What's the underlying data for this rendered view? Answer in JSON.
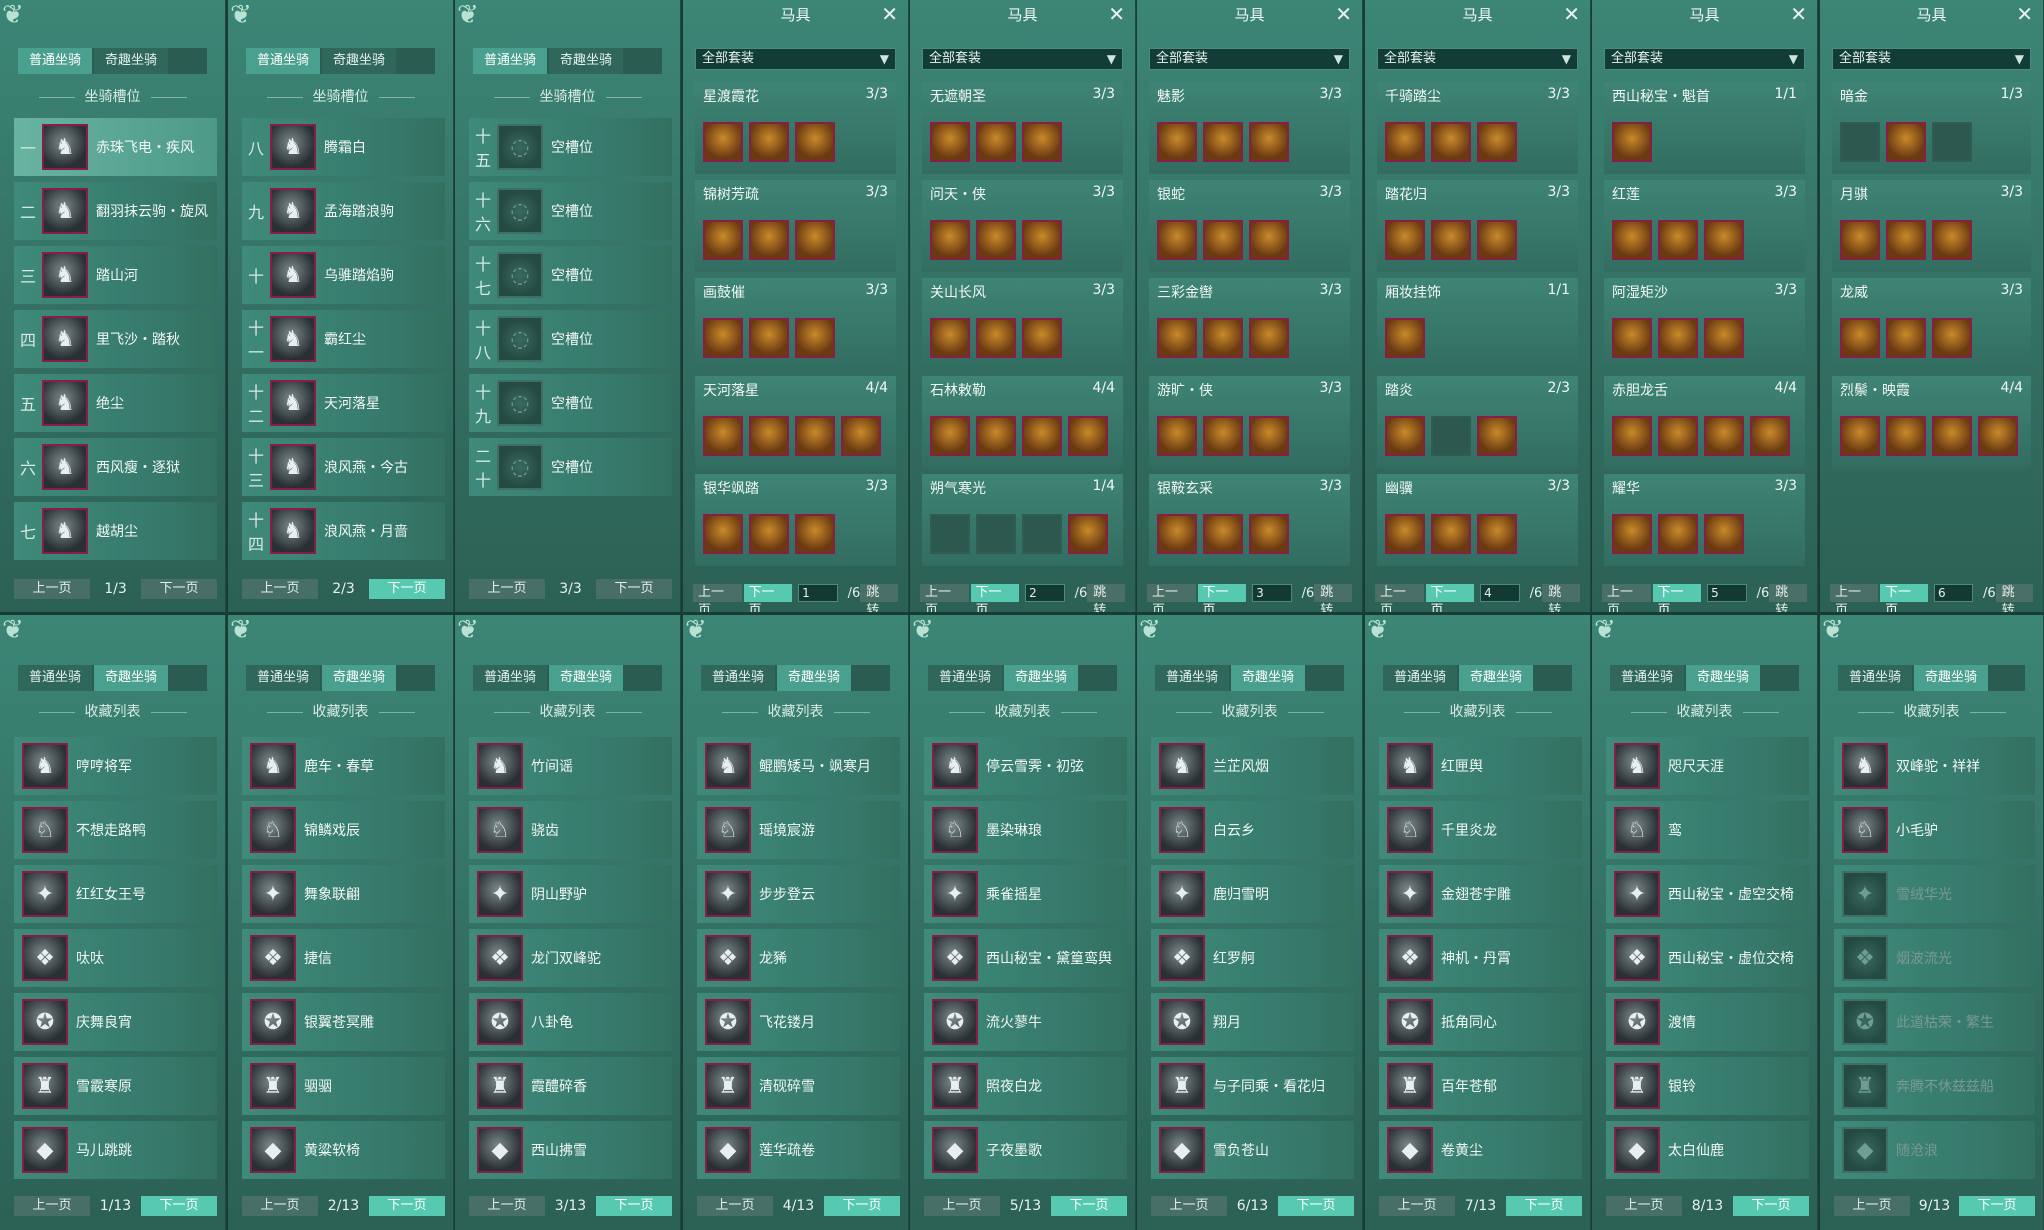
{
  "tabs": {
    "normal": "普通坐骑",
    "fun": "奇趣坐骑"
  },
  "slot_title": "坐骑槽位",
  "collection_title": "收藏列表",
  "prev": "上一页",
  "next": "下一页",
  "slot_panels": [
    {
      "page": "1/3",
      "selected": 0,
      "rows": [
        {
          "num": "一",
          "name": "赤珠飞电・疾风"
        },
        {
          "num": "二",
          "name": "翻羽抹云驹・旋风"
        },
        {
          "num": "三",
          "name": "踏山河"
        },
        {
          "num": "四",
          "name": "里飞沙・踏秋"
        },
        {
          "num": "五",
          "name": "绝尘"
        },
        {
          "num": "六",
          "name": "西风瘦・逐狱"
        },
        {
          "num": "七",
          "name": "越胡尘"
        }
      ]
    },
    {
      "page": "2/3",
      "rows": [
        {
          "num": "八",
          "name": "腾霜白"
        },
        {
          "num": "九",
          "name": "孟海踏浪驹"
        },
        {
          "num": "十",
          "name": "乌骓踏焰驹"
        },
        {
          "num": "十一",
          "name": "霸红尘"
        },
        {
          "num": "十二",
          "name": "天河落星"
        },
        {
          "num": "十三",
          "name": "浪风燕・今古"
        },
        {
          "num": "十四",
          "name": "浪风燕・月啬"
        }
      ]
    },
    {
      "page": "3/3",
      "rows": [
        {
          "num": "十五",
          "name": "空槽位",
          "empty": true
        },
        {
          "num": "十六",
          "name": "空槽位",
          "empty": true
        },
        {
          "num": "十七",
          "name": "空槽位",
          "empty": true
        },
        {
          "num": "十八",
          "name": "空槽位",
          "empty": true
        },
        {
          "num": "十九",
          "name": "空槽位",
          "empty": true
        },
        {
          "num": "二十",
          "name": "空槽位",
          "empty": true
        }
      ]
    }
  ],
  "gear": {
    "title": "马具",
    "dropdown": "全部套装",
    "jump": "跳转",
    "total": "/6",
    "panels": [
      {
        "page": "1",
        "sets": [
          {
            "name": "星渡霞花",
            "count": "3/3",
            "items": 3
          },
          {
            "name": "锦树芳疏",
            "count": "3/3",
            "items": 3
          },
          {
            "name": "画鼓催",
            "count": "3/3",
            "items": 3
          },
          {
            "name": "天河落星",
            "count": "4/4",
            "items": 4
          },
          {
            "name": "银华飒踏",
            "count": "3/3",
            "items": 3
          }
        ]
      },
      {
        "page": "2",
        "sets": [
          {
            "name": "无遮朝圣",
            "count": "3/3",
            "items": 3
          },
          {
            "name": "问天・侠",
            "count": "3/3",
            "items": 3
          },
          {
            "name": "关山长风",
            "count": "3/3",
            "items": 3
          },
          {
            "name": "石林敕勒",
            "count": "4/4",
            "items": 4
          },
          {
            "name": "朔气寒光",
            "count": "1/4",
            "items": 4,
            "empty_slots": [
              0,
              1,
              2
            ]
          }
        ]
      },
      {
        "page": "3",
        "sets": [
          {
            "name": "魅影",
            "count": "3/3",
            "items": 3
          },
          {
            "name": "银蛇",
            "count": "3/3",
            "items": 3
          },
          {
            "name": "三彩金辔",
            "count": "3/3",
            "items": 3
          },
          {
            "name": "游旷・侠",
            "count": "3/3",
            "items": 3
          },
          {
            "name": "银鞍玄采",
            "count": "3/3",
            "items": 3
          }
        ]
      },
      {
        "page": "4",
        "sets": [
          {
            "name": "千骑踏尘",
            "count": "3/3",
            "items": 3
          },
          {
            "name": "踏花归",
            "count": "3/3",
            "items": 3
          },
          {
            "name": "厢妆挂饰",
            "count": "1/1",
            "items": 1
          },
          {
            "name": "踏炎",
            "count": "2/3",
            "items": 3,
            "empty_slots": [
              1
            ]
          },
          {
            "name": "幽骥",
            "count": "3/3",
            "items": 3
          }
        ]
      },
      {
        "page": "5",
        "sets": [
          {
            "name": "西山秘宝・魁首",
            "count": "1/1",
            "items": 1
          },
          {
            "name": "红莲",
            "count": "3/3",
            "items": 3
          },
          {
            "name": "阿湿矩沙",
            "count": "3/3",
            "items": 3
          },
          {
            "name": "赤胆龙舌",
            "count": "4/4",
            "items": 4
          },
          {
            "name": "耀华",
            "count": "3/3",
            "items": 3
          }
        ]
      },
      {
        "page": "6",
        "sets": [
          {
            "name": "暗金",
            "count": "1/3",
            "items": 3,
            "empty_slots": [
              0,
              2
            ]
          },
          {
            "name": "月骐",
            "count": "3/3",
            "items": 3
          },
          {
            "name": "龙威",
            "count": "3/3",
            "items": 3
          },
          {
            "name": "烈鬃・映霞",
            "count": "4/4",
            "items": 4
          }
        ]
      }
    ]
  },
  "collection_panels": [
    {
      "page": "1/13",
      "names": [
        "哼哼将军",
        "不想走路鸭",
        "红红女王号",
        "呔呔",
        "庆舞良宵",
        "雪霰寒原",
        "马儿跳跳"
      ]
    },
    {
      "page": "2/13",
      "names": [
        "鹿车・春草",
        "锦鳞戏辰",
        "舞象联翩",
        "捷信",
        "银翼苍冥雕",
        "骃骃",
        "黄粱软椅"
      ]
    },
    {
      "page": "3/13",
      "names": [
        "竹间谣",
        "骁齿",
        "阴山野驴",
        "龙门双峰驼",
        "八卦龟",
        "霞醴碎香",
        "西山拂雪"
      ]
    },
    {
      "page": "4/13",
      "names": [
        "鲲鹏矮马・飒寒月",
        "瑶境宸游",
        "步步登云",
        "龙豨",
        "飞花镂月",
        "清砚碎雪",
        "莲华疏卷"
      ]
    },
    {
      "page": "5/13",
      "names": [
        "停云雪霁・初弦",
        "墨染琳琅",
        "乘雀摇星",
        "西山秘宝・黛篁鸾舆",
        "流火蓼牛",
        "照夜白龙",
        "子夜墨歌"
      ]
    },
    {
      "page": "6/13",
      "names": [
        "兰芷风烟",
        "白云乡",
        "鹿归雪明",
        "红罗舸",
        "翔月",
        "与子同乘・看花归",
        "雪负苍山"
      ]
    },
    {
      "page": "7/13",
      "names": [
        "红匣舆",
        "千里炎龙",
        "金翅苍宇雕",
        "神机・丹霄",
        "抵角同心",
        "百年苍郁",
        "卷黄尘"
      ]
    },
    {
      "page": "8/13",
      "names": [
        "咫尺天涯",
        "鸾",
        "西山秘宝・虚空交椅",
        "西山秘宝・虚位交椅",
        "渡情",
        "银铃",
        "太白仙鹿"
      ]
    },
    {
      "page": "9/13",
      "names": [
        "双峰驼・祥祥",
        "小毛驴",
        "雪绒华光",
        "烟波流光",
        "此道枯荣・繁生",
        "奔腾不休兹兹船",
        "随沧浪"
      ],
      "dim_from": 2
    }
  ]
}
